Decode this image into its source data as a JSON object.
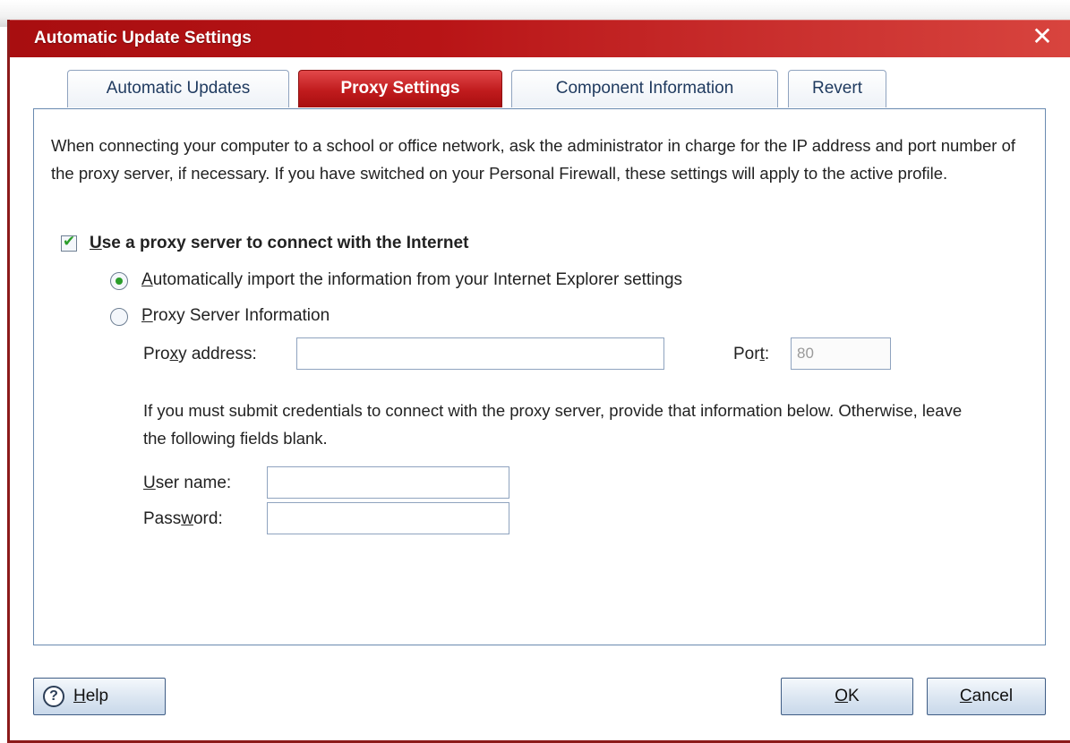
{
  "window": {
    "title": "Automatic Update Settings",
    "close_glyph": "✕"
  },
  "tabs": [
    {
      "label": "Automatic Updates",
      "active": false
    },
    {
      "label": "Proxy Settings",
      "active": true
    },
    {
      "label": "Component Information",
      "active": false
    },
    {
      "label": "Revert",
      "active": false
    }
  ],
  "proxy": {
    "intro_text": "When connecting your computer to a school or office network, ask the administrator in charge for the IP address and port number of the proxy server, if necessary. If you have switched on your Personal Firewall, these settings will apply to the active profile.",
    "use_proxy": {
      "accel": "U",
      "label": "se a proxy server to connect with the Internet",
      "checked": true
    },
    "auto_import": {
      "accel": "A",
      "label": "utomatically import the information from your Internet Explorer settings",
      "selected": true
    },
    "manual": {
      "accel": "P",
      "label": "roxy Server Information",
      "selected": false
    },
    "address": {
      "pre": "Pro",
      "accel": "x",
      "post": "y address:",
      "value": ""
    },
    "port": {
      "pre": "Por",
      "accel": "t",
      "post": ":",
      "value": "80"
    },
    "credentials_note": "If you must submit credentials to connect with the proxy server, provide that information below. Otherwise, leave the following fields blank.",
    "username": {
      "pre": "",
      "accel": "U",
      "post": "ser name:",
      "value": ""
    },
    "password": {
      "pre": "Pass",
      "accel": "w",
      "post": "ord:",
      "value": ""
    }
  },
  "buttons": {
    "help": {
      "accel": "H",
      "rest": "elp",
      "icon": "?"
    },
    "ok": {
      "accel": "O",
      "rest": "K"
    },
    "cancel": {
      "accel": "C",
      "rest": "ancel"
    }
  },
  "colors": {
    "title_bar": "#b81416",
    "active_tab": "#c01b1d",
    "check_green": "#2a9d2a",
    "border_blue": "#6a8ab0"
  }
}
